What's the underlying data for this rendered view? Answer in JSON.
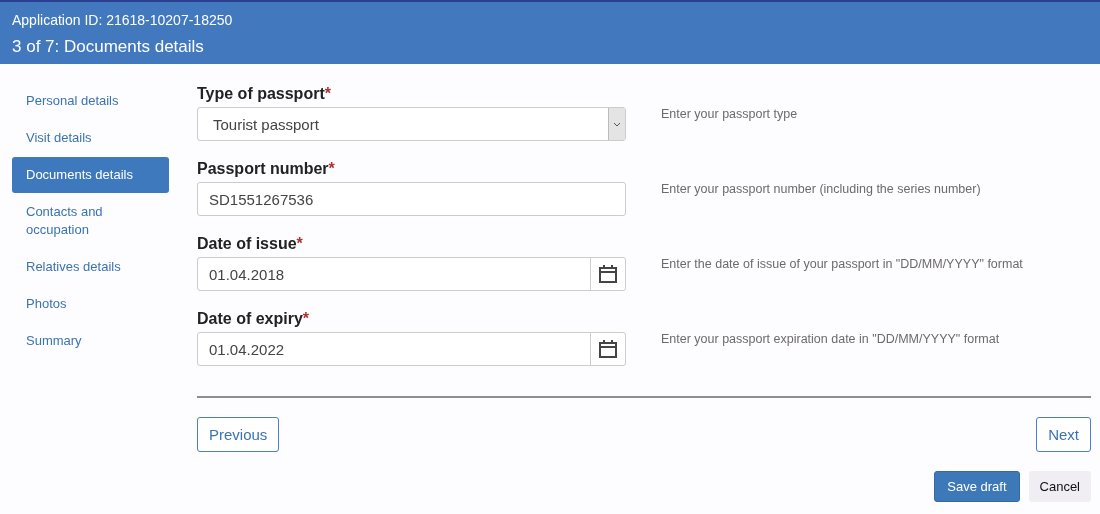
{
  "header": {
    "application_id": "Application ID: 21618-10207-18250",
    "step_title": "3 of 7: Documents details"
  },
  "sidebar": {
    "items": [
      {
        "label": "Personal details",
        "selected": false
      },
      {
        "label": "Visit details",
        "selected": false
      },
      {
        "label": "Documents details",
        "selected": true
      },
      {
        "label": "Contacts and occupation",
        "selected": false
      },
      {
        "label": "Relatives details",
        "selected": false
      },
      {
        "label": "Photos",
        "selected": false
      },
      {
        "label": "Summary",
        "selected": false
      }
    ]
  },
  "fields": [
    {
      "kind": "select",
      "label": "Type of passport",
      "required_mark": "*",
      "value": "Tourist passport",
      "hint": "Enter your passport type"
    },
    {
      "kind": "text",
      "label": "Passport number",
      "required_mark": "*",
      "value": "SD1551267536",
      "hint": "Enter your passport number (including the series number)"
    },
    {
      "kind": "date",
      "label": "Date of issue",
      "required_mark": "*",
      "value": "01.04.2018",
      "hint": "Enter the date of issue of your passport in \"DD/MM/YYYY\" format"
    },
    {
      "kind": "date",
      "label": "Date of expiry",
      "required_mark": "*",
      "value": "01.04.2022",
      "hint": "Enter your passport expiration date in \"DD/MM/YYYY\" format"
    }
  ],
  "navigation": {
    "previous": "Previous",
    "next": "Next"
  },
  "actions": {
    "save": "Save draft",
    "cancel": "Cancel"
  }
}
